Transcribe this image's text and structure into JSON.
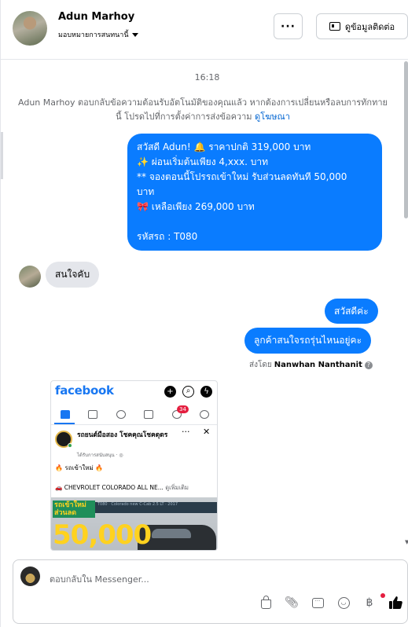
{
  "header": {
    "name": "Adun Marhoy",
    "assign_label": "มอบหมายการสนทนานี้",
    "more_label": "···",
    "contact_label": "ดูข้อมูลติดต่อ"
  },
  "thread": {
    "time": "16:18",
    "notice_text": "Adun Marhoy ตอบกลับข้อความต้อนรับอัตโนมัติของคุณแล้ว หากต้องการเปลี่ยนหรือลบการทักทายนี้ โปรดไปที่การตั้งค่าการส่งข้อความ",
    "notice_link": "ดูโฆษณา",
    "auto_message": {
      "line1": "สวัสดี Adun! 🔔  ราคาปกติ  319,000 บาท",
      "line2": "✨  ผ่อนเริ่มต้นเพียง 4,xxx. บาท",
      "line3": "** จองตอนนี้โปรรถเข้าใหม่ รับส่วนลดทันที 50,000",
      "line4": "บาท",
      "line5": "🎀  เหลือเพียง 269,000 บาท",
      "line6": "",
      "line7": "รหัสรถ : T080"
    },
    "incoming": "สนใจคับ",
    "outgoing_1": "สวัสดีค่ะ",
    "outgoing_2": "ลูกค้าสนใจรถรุ่นไหนอยู่คะ",
    "sent_by_prefix": "ส่งโดย",
    "sent_by_name": "Nanwhan Nanthanit",
    "help_icon": "?"
  },
  "shared_post": {
    "app_name": "facebook",
    "notif_count": "34",
    "page_name": "รถยนต์มือสอง โชคคุณโชคดุดร",
    "page_meta": "ได้รับการสนับสนุน · ◎",
    "line1": "🔥 รถเข้าใหม่ 🔥",
    "line2": "🚗  CHEVROLET COLORADO ALL NE...",
    "line2_more": "ดูเพิ่มเติม",
    "banner_text": "รถเข้าใหม่ ส่วนลด",
    "strip_text": "T080 · Colorado new C-Cab 2.5 LT · 2017",
    "big_text": "50,000"
  },
  "composer": {
    "placeholder": "ตอบกลับใน Messenger..."
  },
  "icons": {
    "more": "more-dots-icon",
    "contact": "contact-card-icon",
    "baht": "฿",
    "thumb": "thumbs-up-icon"
  },
  "colors": {
    "brand_blue": "#0a7cff",
    "fb_blue": "#1877f2",
    "link": "#0064d1"
  }
}
